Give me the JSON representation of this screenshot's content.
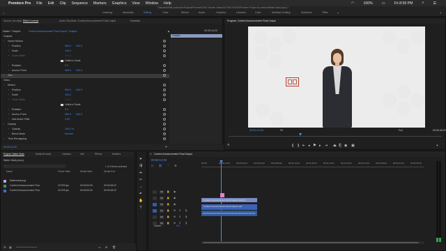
{
  "menubar": {
    "apple": "",
    "items": [
      "Premiere Pro",
      "File",
      "Edit",
      "Clip",
      "Sequence",
      "Markers",
      "Graphics",
      "View",
      "Window",
      "Help"
    ],
    "battery": "100%",
    "clock": "Fri 8:59 PM"
  },
  "path": "/Volumes/HMB production/Projects/Premiere/2016 October Videos/01 PAID VIDEO/Premiere Project for personal/Water Mark.prproj *",
  "workspaces": [
    {
      "label": "Learning",
      "active": false
    },
    {
      "label": "Assembly",
      "active": false
    },
    {
      "label": "Editing",
      "active": true
    },
    {
      "label": "Color",
      "active": false
    },
    {
      "label": "Effects",
      "active": false
    },
    {
      "label": "Audio",
      "active": false
    },
    {
      "label": "Graphics",
      "active": false
    },
    {
      "label": "Libraries",
      "active": false
    },
    {
      "label": "Color",
      "active": false
    },
    {
      "label": "Multicam Editing",
      "active": false
    },
    {
      "label": "Notebook",
      "active": false
    },
    {
      "label": "Titles",
      "active": false
    }
  ],
  "effect_controls": {
    "tabs": [
      "Source: (no clips)",
      "Effect Controls",
      "Audio Clip Mixer: Context Announcement Final Output",
      "Metadata"
    ],
    "header_left": "Master * Graphic",
    "header_right": "Context Announcement Final Output * Graphic",
    "timecode": "00:00:14:23",
    "graphic_bar": "Graphic",
    "rows": [
      {
        "label": "Graphic",
        "indent": 0,
        "value": "",
        "value2": ""
      },
      {
        "label": "Vector Motion",
        "indent": 1,
        "value": "",
        "value2": ""
      },
      {
        "label": "Position",
        "indent": 2,
        "value": "960.0",
        "value2": "540.0"
      },
      {
        "label": "Scale",
        "indent": 2,
        "value": "100.0",
        "value2": ""
      },
      {
        "label": "Scale Width",
        "indent": 2,
        "value": "100.0",
        "value2": "",
        "dim": true
      },
      {
        "label": "Uniform Scale",
        "indent": 3,
        "value": "",
        "value2": "",
        "check": true
      },
      {
        "label": "Rotation",
        "indent": 2,
        "value": "0.0",
        "value2": ""
      },
      {
        "label": "Anchor Point",
        "indent": 2,
        "value": "960.0",
        "value2": "540.0"
      },
      {
        "label": "Text",
        "indent": 1,
        "value": "",
        "value2": "",
        "selected": true
      },
      {
        "label": "Video",
        "indent": 0,
        "value": "",
        "value2": ""
      },
      {
        "label": "Motion",
        "indent": 1,
        "value": "",
        "value2": ""
      },
      {
        "label": "Position",
        "indent": 2,
        "value": "960.0",
        "value2": "540.0"
      },
      {
        "label": "Scale",
        "indent": 2,
        "value": "100.0",
        "value2": ""
      },
      {
        "label": "Scale Width",
        "indent": 2,
        "value": "100.0",
        "value2": "",
        "dim": true
      },
      {
        "label": "Uniform Scale",
        "indent": 3,
        "value": "",
        "value2": "",
        "check": true
      },
      {
        "label": "Rotation",
        "indent": 2,
        "value": "0.0",
        "value2": ""
      },
      {
        "label": "Anchor Point",
        "indent": 2,
        "value": "960.0",
        "value2": "540.0"
      },
      {
        "label": "Anti-flicker Filter",
        "indent": 2,
        "value": "0.00",
        "value2": ""
      },
      {
        "label": "Opacity",
        "indent": 1,
        "value": "",
        "value2": ""
      },
      {
        "label": "Opacity",
        "indent": 2,
        "value": "100.0 %",
        "value2": ""
      },
      {
        "label": "Blend Mode",
        "indent": 2,
        "value": "Normal",
        "value2": ""
      },
      {
        "label": "Time Remapping",
        "indent": 1,
        "value": "",
        "value2": ""
      }
    ],
    "footer_time": "00:00:14:00"
  },
  "program": {
    "title": "Program: Context Announcement Final Output",
    "timecode": "00:00:14:00",
    "fit": "Fit",
    "quality": "Full",
    "duration": "00:00:48:22"
  },
  "project": {
    "tabs": [
      "Project: Water Mark",
      "Media Browser",
      "Libraries",
      "Info",
      "Effects",
      "Markers"
    ],
    "name": "Water Mark.prproj",
    "selection": "1 of 3 items selected",
    "columns": [
      "Name",
      "Frame Rate",
      "Media Start",
      "Media End"
    ],
    "rows": [
      {
        "name": "Watermark.png",
        "rate": "",
        "start": "",
        "end": "",
        "color": "#c99be0"
      },
      {
        "name": "Context Announcement Fina",
        "rate": "23.976 fps",
        "start": "00:00:00:00",
        "end": "00:00:48:22",
        "color": "#3a9b4c"
      },
      {
        "name": "Context Announcement Fina",
        "rate": "23.976 fps",
        "start": "00:00:00:00",
        "end": "00:00:48:22",
        "color": "#3a6bd8"
      }
    ]
  },
  "timeline": {
    "tab": "Context Announcement Final Output",
    "timecode": "00:00:14:00",
    "ruler": [
      "00:00",
      "00:00:14:23",
      "00:00:29:23",
      "00:00:44:22",
      "00:00:59:22",
      "00:01:14:22",
      "00:01:29:21",
      "00:01:44:21",
      "00:01:59:21",
      "00:02:14:20",
      "00:02:29:20",
      "00:02:44:19",
      "00:02:59:19"
    ],
    "tracks": [
      "V3",
      "V2",
      "V1",
      "A1",
      "A2",
      "A3"
    ],
    "master_label": "Master",
    "master_value": "0.0",
    "clip_graphic": "Context Announcement Final Output.mp4 [V]",
    "clip_audio": "Context Announcement Final Output.mp4"
  }
}
